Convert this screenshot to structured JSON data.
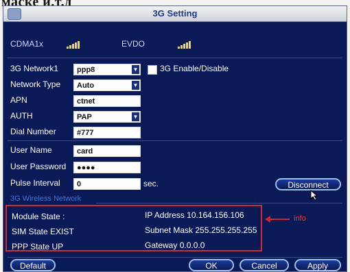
{
  "caption": "маске и.т.д",
  "window": {
    "title": "3G Setting"
  },
  "signals": [
    {
      "label": "CDMA1x"
    },
    {
      "label": "EVDO"
    }
  ],
  "form": {
    "network": {
      "label": "3G Network1",
      "value": "ppp8"
    },
    "enable": {
      "label": "3G Enable/Disable"
    },
    "network_type": {
      "label": "Network Type",
      "value": "Auto"
    },
    "apn": {
      "label": "APN",
      "value": "ctnet"
    },
    "auth": {
      "label": "AUTH",
      "value": "PAP"
    },
    "dial": {
      "label": "Dial Number",
      "value": "#777"
    },
    "user": {
      "label": "User Name",
      "value": "card"
    },
    "password": {
      "label": "User Password",
      "value": "●●●●"
    },
    "pulse": {
      "label": "Pulse Interval",
      "value": "0",
      "unit": "sec."
    }
  },
  "buttons": {
    "disconnect": "Disconnect",
    "default": "Default",
    "ok": "OK",
    "cancel": "Cancel",
    "apply": "Apply"
  },
  "wireless": {
    "title": "3G Wireless Network",
    "module_state": "Module State :",
    "sim_state": "SIM State  EXIST",
    "ppp_state": "PPP State  UP",
    "ip": "IP Address  10.164.156.106",
    "mask": "Subnet Mask  255.255.255.255",
    "gateway": "Gateway  0.0.0.0"
  },
  "annotation": {
    "text": "info",
    "color": "#e02020"
  }
}
